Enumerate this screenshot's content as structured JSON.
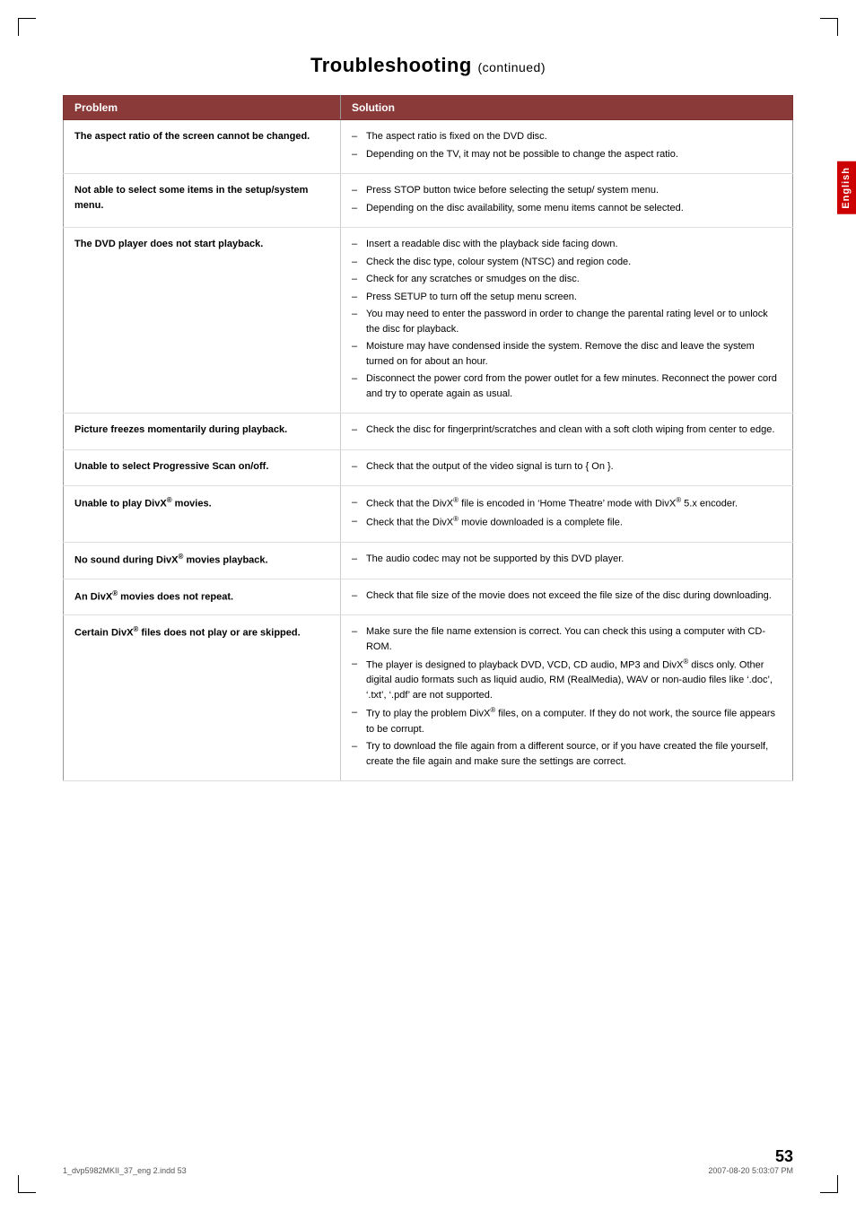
{
  "page": {
    "title": "Troubleshooting",
    "title_suffix": "(continued)",
    "page_number": "53",
    "footer_left": "1_dvp5982MKII_37_eng 2.indd   53",
    "footer_right": "2007-08-20   5:03:07 PM",
    "language_tab": "English"
  },
  "table": {
    "headers": {
      "problem": "Problem",
      "solution": "Solution"
    },
    "rows": [
      {
        "problem": "The aspect ratio of the screen cannot be changed.",
        "solutions": [
          "The aspect ratio is fixed on the DVD disc.",
          "Depending on the TV, it may not be possible to change the aspect ratio."
        ]
      },
      {
        "problem": "Not able to select some items in the setup/system menu.",
        "solutions": [
          "Press STOP button twice before selecting the setup/ system menu.",
          "Depending on the disc availability, some menu items cannot be selected."
        ]
      },
      {
        "problem": "The DVD player does not start playback.",
        "solutions": [
          "Insert a readable disc with the playback side facing down.",
          "Check the disc type, colour system (NTSC) and region code.",
          "Check for any scratches or smudges on the disc.",
          "Press SETUP to turn off the setup menu screen.",
          "You may need to enter the password in order to change the parental rating level or to unlock the disc for playback.",
          "Moisture may have condensed inside the system. Remove the disc and leave the system turned on for about an hour.",
          "Disconnect the power cord from the power outlet for a few minutes. Reconnect the power cord and try to operate again as usual."
        ]
      },
      {
        "problem": "Picture freezes momentarily during playback.",
        "solutions": [
          "Check the disc for fingerprint/scratches and clean with a soft cloth wiping from center to edge."
        ]
      },
      {
        "problem": "Unable to select Progressive Scan on/off.",
        "solutions": [
          "Check that the output of the video signal is turn to { On }."
        ]
      },
      {
        "problem": "Unable to play DivX® movies.",
        "solutions": [
          "Check that the DivX® file is encoded in ‘Home Theatre’ mode with DivX® 5.x encoder.",
          "Check that the DivX® movie downloaded is a complete file."
        ]
      },
      {
        "problem": "No sound during DivX® movies playback.",
        "solutions": [
          "The audio codec may not be supported by this DVD player."
        ]
      },
      {
        "problem": "An DivX® movies does not repeat.",
        "solutions": [
          "Check that file size of the movie does not exceed the file size of the disc during downloading."
        ]
      },
      {
        "problem": "Certain DivX® files does not play or are skipped.",
        "solutions": [
          "Make sure the file name extension is correct. You can check this using a computer with CD-ROM.",
          "The player is designed to playback DVD, VCD, CD audio, MP3 and DivX® discs only. Other digital audio formats such as liquid audio, RM (RealMedia), WAV or non-audio files like ‘.doc’, ‘.txt’, ‘.pdf’ are not supported.",
          "Try to play the problem DivX® files, on a computer. If they do not work, the source file appears to be corrupt.",
          "Try to download the file again from a different source, or if you have created the file yourself, create the file again and make sure the settings are correct."
        ]
      }
    ]
  }
}
